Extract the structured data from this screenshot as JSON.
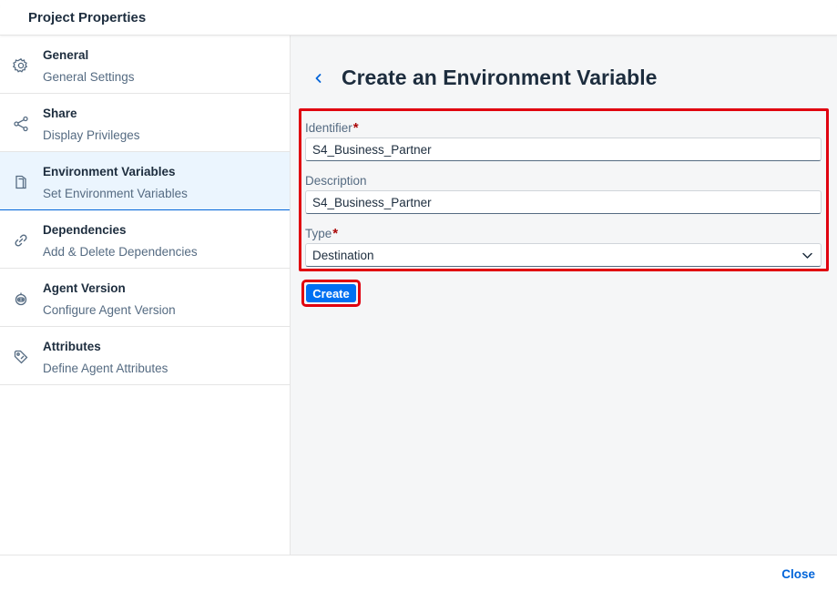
{
  "dialog": {
    "title": "Project Properties"
  },
  "sidebar": {
    "items": [
      {
        "title": "General",
        "subtitle": "General Settings",
        "icon": "gear-icon"
      },
      {
        "title": "Share",
        "subtitle": "Display Privileges",
        "icon": "share-icon"
      },
      {
        "title": "Environment Variables",
        "subtitle": "Set Environment Variables",
        "icon": "document-icon",
        "selected": true
      },
      {
        "title": "Dependencies",
        "subtitle": "Add & Delete Dependencies",
        "icon": "link-icon"
      },
      {
        "title": "Agent Version",
        "subtitle": "Configure Agent Version",
        "icon": "robot-icon"
      },
      {
        "title": "Attributes",
        "subtitle": "Define Agent Attributes",
        "icon": "tag-icon"
      }
    ]
  },
  "main": {
    "title": "Create an Environment Variable",
    "form": {
      "identifier_label": "Identifier",
      "identifier_value": "S4_Business_Partner",
      "description_label": "Description",
      "description_value": "S4_Business_Partner",
      "type_label": "Type",
      "type_value": "Destination",
      "required_marker": "*"
    },
    "create_label": "Create"
  },
  "footer": {
    "close_label": "Close"
  },
  "colors": {
    "accent": "#0070f2",
    "highlight": "#e0000f",
    "selected_bg": "#ebf5fe",
    "required": "#aa0808"
  }
}
